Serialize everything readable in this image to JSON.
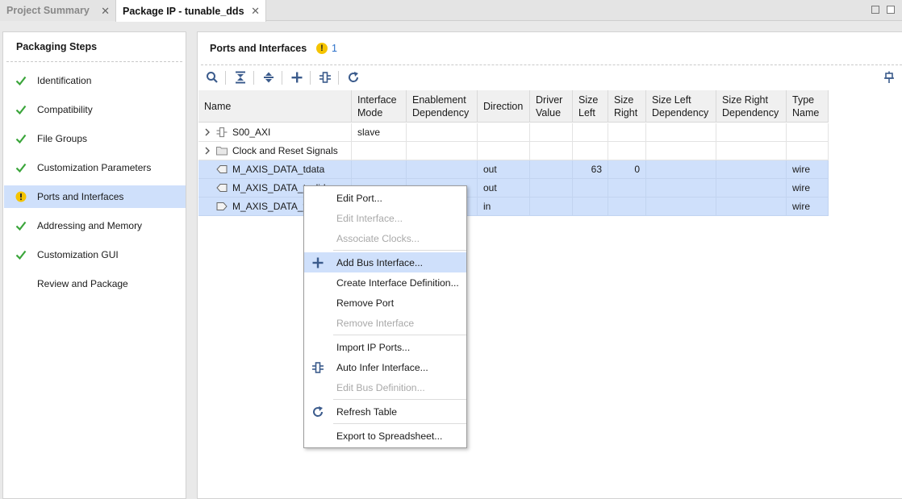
{
  "tabs": [
    {
      "label": "Project Summary"
    },
    {
      "label": "Package IP - tunable_dds"
    }
  ],
  "steps_panel": {
    "title": "Packaging Steps",
    "steps": [
      {
        "label": "Identification",
        "status": "done"
      },
      {
        "label": "Compatibility",
        "status": "done"
      },
      {
        "label": "File Groups",
        "status": "done"
      },
      {
        "label": "Customization Parameters",
        "status": "done"
      },
      {
        "label": "Ports and Interfaces",
        "status": "warning"
      },
      {
        "label": "Addressing and Memory",
        "status": "done"
      },
      {
        "label": "Customization GUI",
        "status": "done"
      },
      {
        "label": "Review and Package",
        "status": "none"
      }
    ]
  },
  "ports_panel": {
    "title": "Ports and Interfaces",
    "warning_count": "1",
    "toolbar": [
      "search-icon",
      "collapse-all-icon",
      "expand-all-icon",
      "add-icon",
      "auto-infer-icon",
      "refresh-icon"
    ]
  },
  "table": {
    "headers": [
      "Name",
      "Interface Mode",
      "Enablement Dependency",
      "Direction",
      "Driver Value",
      "Size Left",
      "Size Right",
      "Size Left Dependency",
      "Size Right Dependency",
      "Type Name"
    ],
    "rows": [
      {
        "name": "S00_AXI",
        "mode": "slave",
        "enable": "",
        "dir": "",
        "driver": "",
        "size_left": "",
        "size_right": "",
        "sl_dep": "",
        "sr_dep": "",
        "type": ""
      },
      {
        "name": "Clock and Reset Signals",
        "mode": "",
        "enable": "",
        "dir": "",
        "driver": "",
        "size_left": "",
        "size_right": "",
        "sl_dep": "",
        "sr_dep": "",
        "type": ""
      },
      {
        "name": "M_AXIS_DATA_tdata",
        "mode": "",
        "enable": "",
        "dir": "out",
        "driver": "",
        "size_left": "63",
        "size_right": "0",
        "sl_dep": "",
        "sr_dep": "",
        "type": "wire"
      },
      {
        "name": "M_AXIS_DATA_tvalid",
        "mode": "",
        "enable": "",
        "dir": "out",
        "driver": "",
        "size_left": "",
        "size_right": "",
        "sl_dep": "",
        "sr_dep": "",
        "type": "wire"
      },
      {
        "name": "M_AXIS_DATA_tready",
        "mode": "",
        "enable": "",
        "dir": "in",
        "driver": "",
        "size_left": "",
        "size_right": "",
        "sl_dep": "",
        "sr_dep": "",
        "type": "wire"
      }
    ]
  },
  "context_menu": {
    "items": [
      {
        "label": "Edit Port...",
        "enabled": true
      },
      {
        "label": "Edit Interface...",
        "enabled": false
      },
      {
        "label": "Associate Clocks...",
        "enabled": false
      },
      {
        "label": "Add Bus Interface...",
        "enabled": true,
        "icon": "plus-icon"
      },
      {
        "label": "Create Interface Definition...",
        "enabled": true
      },
      {
        "label": "Remove Port",
        "enabled": true
      },
      {
        "label": "Remove Interface",
        "enabled": false
      },
      {
        "label": "Import IP Ports...",
        "enabled": true
      },
      {
        "label": "Auto Infer Interface...",
        "enabled": true,
        "icon": "auto-infer-icon"
      },
      {
        "label": "Edit Bus Definition...",
        "enabled": false
      },
      {
        "label": "Refresh Table",
        "enabled": true,
        "icon": "refresh-icon"
      },
      {
        "label": "Export to Spreadsheet...",
        "enabled": true
      }
    ]
  },
  "colors": {
    "selection": "#cfe0fb",
    "check_green": "#3aa53a",
    "warning_yellow": "#f5c400",
    "icon_blue": "#3b5b8c"
  }
}
